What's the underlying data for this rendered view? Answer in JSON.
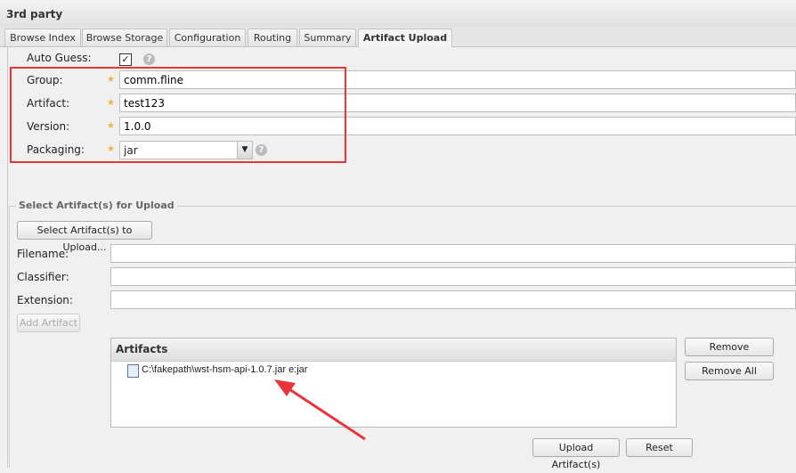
{
  "panel_title": "3rd party",
  "tabs": [
    {
      "label": "Browse Index"
    },
    {
      "label": "Browse Storage"
    },
    {
      "label": "Configuration"
    },
    {
      "label": "Routing"
    },
    {
      "label": "Summary"
    },
    {
      "label": "Artifact Upload",
      "active": true
    }
  ],
  "form": {
    "auto_guess_label": "Auto Guess:",
    "auto_guess_checked": true,
    "group_label": "Group:",
    "group_value": "comm.fline",
    "artifact_label": "Artifact:",
    "artifact_value": "test123",
    "version_label": "Version:",
    "version_value": "1.0.0",
    "packaging_label": "Packaging:",
    "packaging_value": "jar",
    "help": "?",
    "required_marker": "★"
  },
  "upload": {
    "legend": "Select Artifact(s) for Upload",
    "select_button": "Select Artifact(s) to Upload...",
    "filename_label": "Filename:",
    "filename_value": "",
    "classifier_label": "Classifier:",
    "classifier_value": "",
    "extension_label": "Extension:",
    "extension_value": "",
    "add_button": "Add Artifact",
    "grid_header": "Artifacts",
    "artifacts": [
      {
        "text": "C:\\fakepath\\wst-hsm-api-1.0.7.jar e:jar"
      }
    ],
    "remove_button": "Remove",
    "remove_all_button": "Remove All",
    "upload_button": "Upload Artifact(s)",
    "reset_button": "Reset"
  },
  "annotation_color": "#e8353a"
}
